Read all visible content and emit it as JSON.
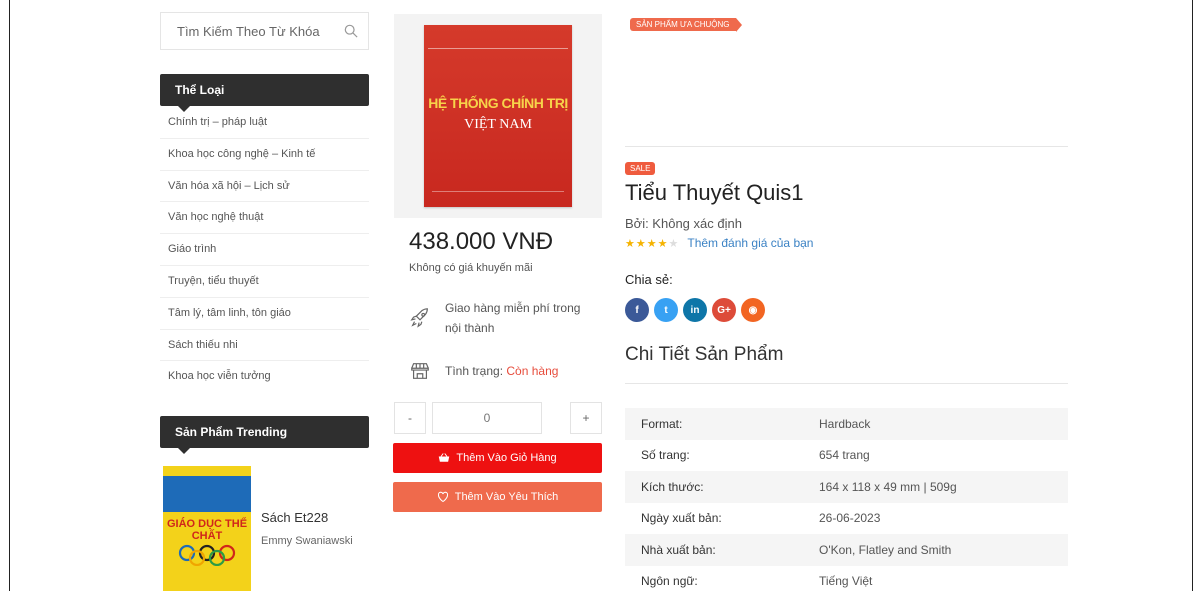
{
  "search": {
    "placeholder": "Tìm Kiếm Theo Từ Khóa"
  },
  "sidebar": {
    "category_heading": "Thể Loại",
    "categories": [
      "Chính trị – pháp luật",
      "Khoa học công nghệ – Kinh tế",
      "Văn hóa xã hội – Lịch sử",
      "Văn học nghệ thuật",
      "Giáo trình",
      "Truyện, tiểu thuyết",
      "Tâm lý, tâm linh, tôn giáo",
      "Sách thiếu nhi",
      "Khoa học viễn tưởng"
    ],
    "trending_heading": "Sản Phẩm Trending",
    "trending_item": {
      "title": "Sách Et228",
      "author": "Emmy Swaniawski",
      "cover_text": "GIÁO DỤC THỂ CHẤT"
    }
  },
  "product": {
    "cover": {
      "line1": "HỆ THỐNG CHÍNH TRỊ",
      "line2": "VIỆT NAM"
    },
    "price": "438.000 VNĐ",
    "promo": "Không có giá khuyến mãi",
    "shipping": "Giao hàng miễn phí trong nội thành",
    "stock_label": "Tình trạng:",
    "stock_value": "Còn hàng",
    "quantity": "0",
    "qty_minus": "-",
    "qty_plus": "+",
    "add_to_cart": "Thêm Vào Giỏ Hàng",
    "add_to_wishlist": "Thêm Vào Yêu Thích",
    "favorite_badge": "SẢN PHẨM ƯA CHUỘNG",
    "sale_badge": "SALE",
    "title": "Tiểu Thuyết Quis1",
    "by": "Bởi: Không xác định",
    "rating": 4,
    "rating_max": 5,
    "rate_link": "Thêm đánh giá của bạn",
    "share_label": "Chia sẻ:",
    "social": [
      {
        "icon": "facebook-icon",
        "glyph": "f",
        "color": "#3b5998"
      },
      {
        "icon": "twitter-icon",
        "glyph": "t",
        "color": "#38a1f3"
      },
      {
        "icon": "linkedin-icon",
        "glyph": "in",
        "color": "#0e76a8"
      },
      {
        "icon": "googleplus-icon",
        "glyph": "G+",
        "color": "#dd4b39"
      },
      {
        "icon": "rss-icon",
        "glyph": "◉",
        "color": "#f26522"
      }
    ],
    "details_title": "Chi Tiết Sản Phẩm",
    "specs": [
      {
        "key": "Format:",
        "value": "Hardback"
      },
      {
        "key": "Số trang:",
        "value": "654 trang"
      },
      {
        "key": "Kích thước:",
        "value": "164 x 118 x 49 mm | 509g"
      },
      {
        "key": "Ngày xuất bản:",
        "value": "26-06-2023"
      },
      {
        "key": "Nhà xuất bản:",
        "value": "O'Kon, Flatley and Smith"
      },
      {
        "key": "Ngôn ngữ:",
        "value": "Tiếng Việt"
      }
    ]
  },
  "colors": {
    "cart": "#ee1111",
    "wishlist": "#ef6a4c",
    "accent": "#ef5b3e",
    "link": "#3b82c4"
  }
}
